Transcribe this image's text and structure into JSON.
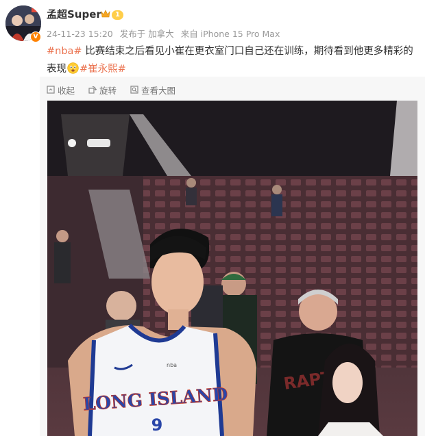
{
  "user": {
    "name": "孟超Super",
    "level": "1",
    "verified_mark": "V"
  },
  "meta": {
    "timestamp": "24-11-23 15:20",
    "location": "发布于 加拿大",
    "device": "来自 iPhone 15 Pro Max"
  },
  "post": {
    "tag1": "#nba#",
    "text": " 比赛结束之后看见小崔在更衣室门口自己还在训练，期待看到他更多精彩的表现",
    "tag2": "#崔永熙#"
  },
  "toolbar": {
    "collapse_label": "收起",
    "rotate_label": "旋转",
    "view_large_label": "查看大图"
  },
  "photo": {
    "jersey_text": "LONG ISLAND",
    "jersey_number": "9",
    "shirt_text": "RAPTORS",
    "jersey_brand": "nba"
  },
  "colors": {
    "tag": "#eb7350",
    "verified": "#ff8200",
    "level_badge": "#ffce4a",
    "jersey_blue": "#1f3a93"
  },
  "icons": [
    "crown-icon",
    "verified-badge-icon",
    "emoji-icon",
    "collapse-icon",
    "rotate-icon",
    "zoom-icon"
  ]
}
